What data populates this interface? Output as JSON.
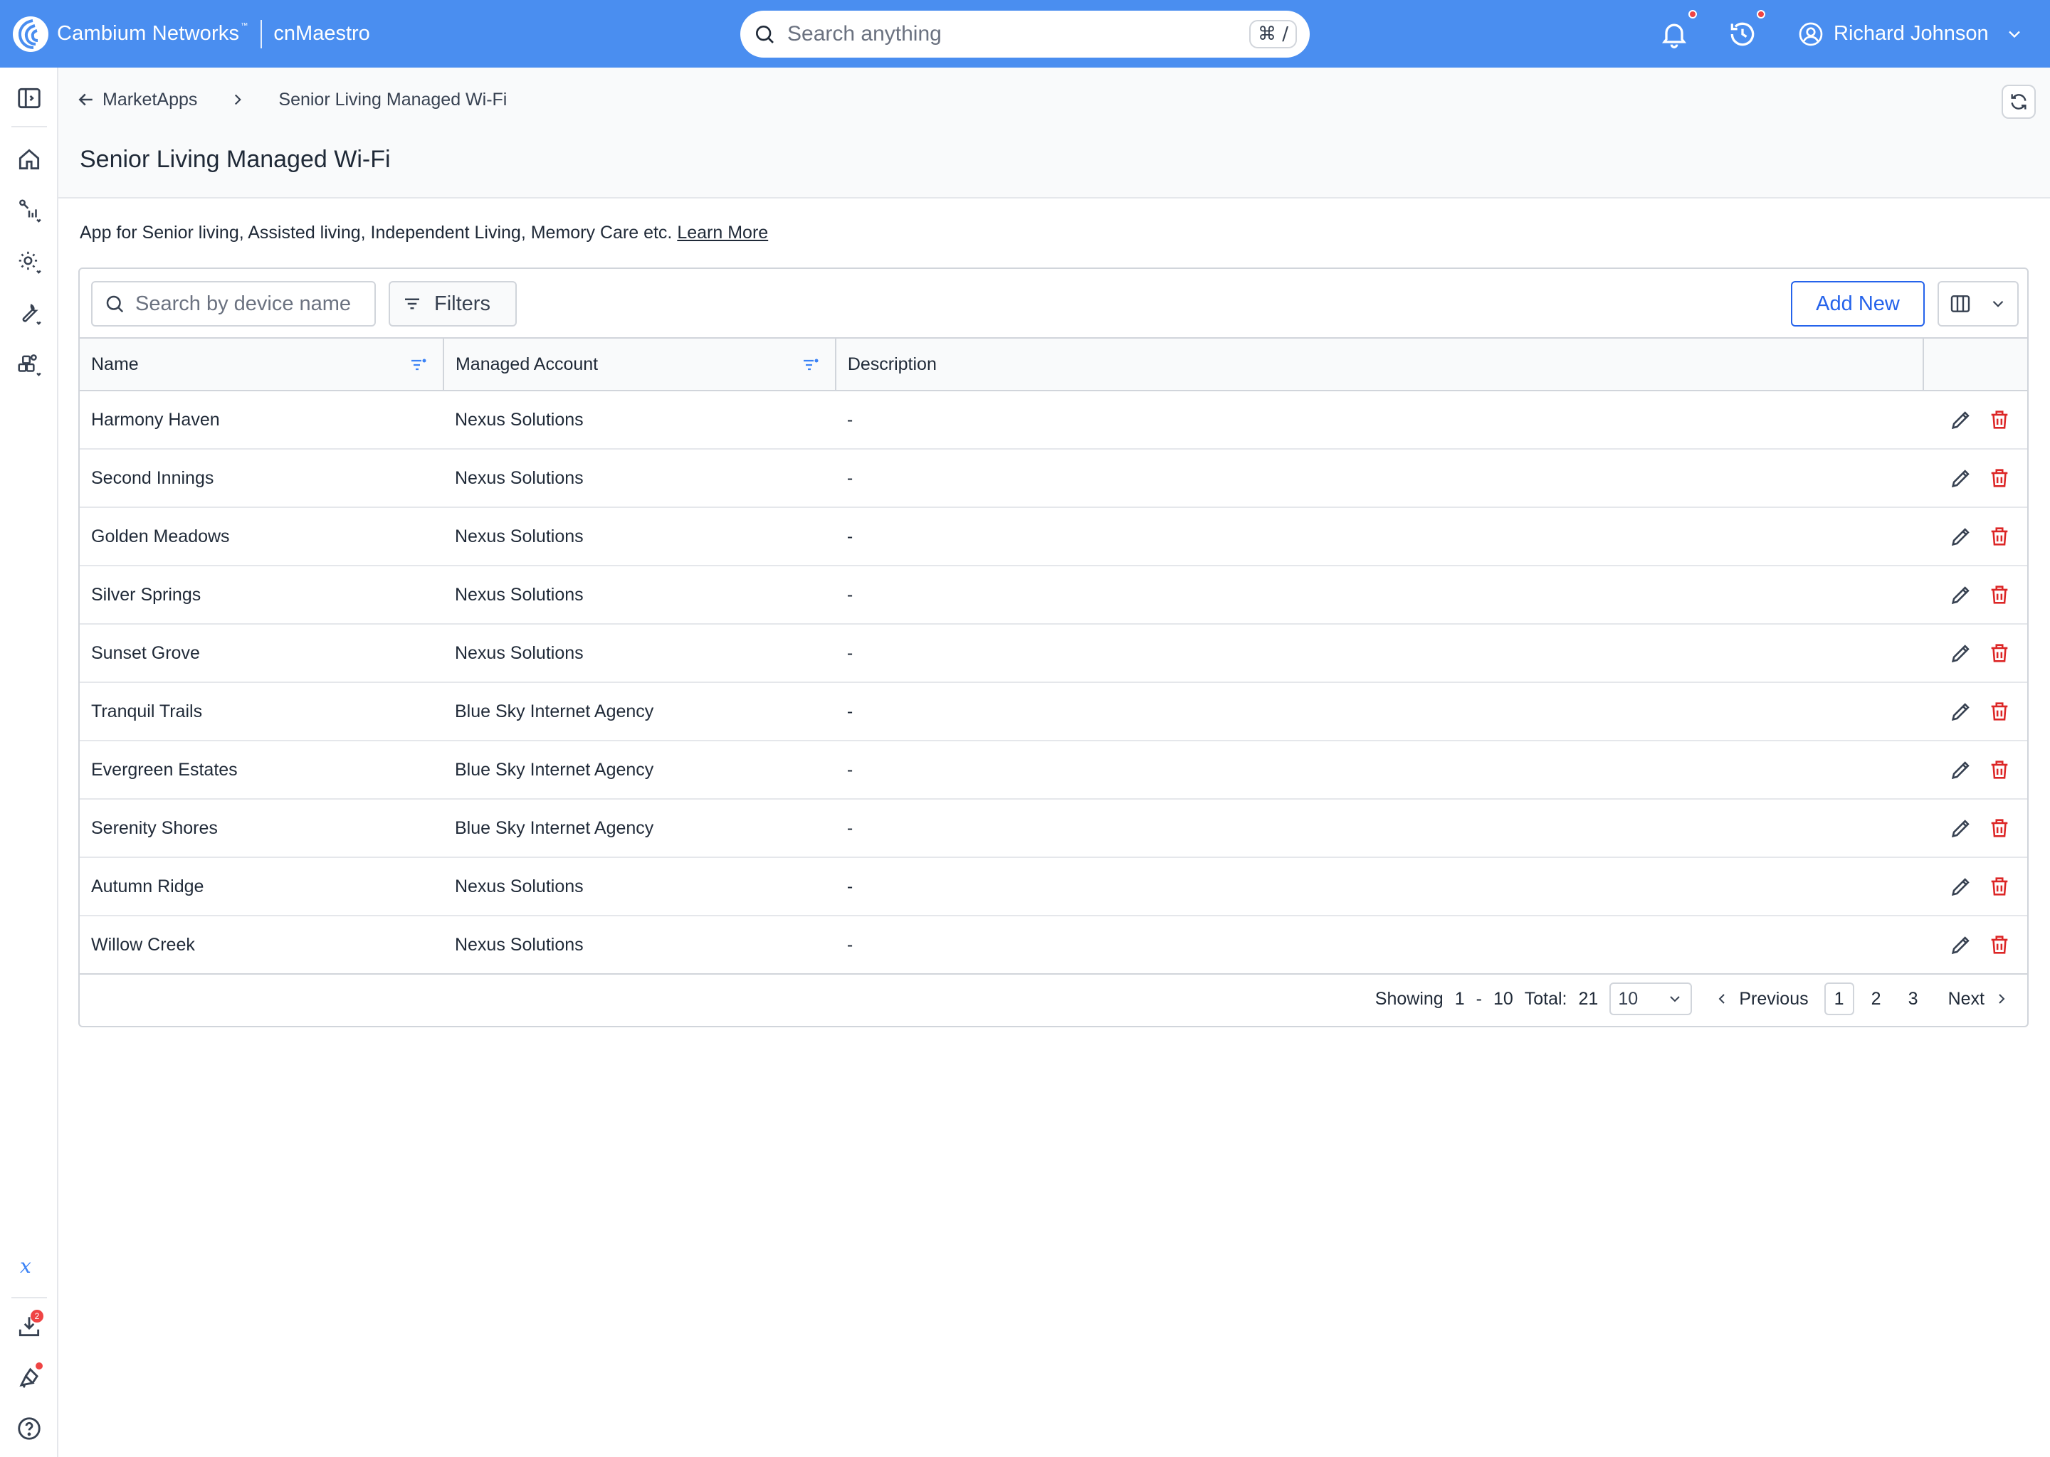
{
  "topbar": {
    "company": "Cambium Networks",
    "trademark": "™",
    "product": "cnMaestro",
    "search_placeholder": "Search anything",
    "search_shortcut": "⌘ /",
    "user_name": "Richard Johnson",
    "icons": [
      "cambium-logo-icon",
      "bell-icon",
      "activity-history-icon",
      "user-circle-icon",
      "chevron-down-icon"
    ]
  },
  "rail": {
    "icons": [
      "sidebar-toggle-icon",
      "home-icon",
      "monitor-icon",
      "configure-icon",
      "tools-icon",
      "apps-icon",
      "x-logo-icon",
      "download-icon",
      "announcement-icon",
      "help-icon"
    ],
    "download_badge": "2"
  },
  "breadcrumb": {
    "parent": "MarketApps",
    "current": "Senior Living Managed Wi-Fi"
  },
  "page": {
    "title": "Senior Living Managed Wi-Fi",
    "description": "App for Senior living, Assisted living, Independent Living, Memory Care etc.",
    "learn_more": "Learn More"
  },
  "toolbar": {
    "search_placeholder": "Search by device name",
    "filters_label": "Filters",
    "add_label": "Add New"
  },
  "table": {
    "columns": [
      "Name",
      "Managed Account",
      "Description"
    ],
    "rows": [
      {
        "name": "Harmony Haven",
        "account": "Nexus Solutions",
        "description": "-"
      },
      {
        "name": "Second Innings",
        "account": "Nexus Solutions",
        "description": "-"
      },
      {
        "name": "Golden Meadows",
        "account": "Nexus Solutions",
        "description": "-"
      },
      {
        "name": "Silver Springs",
        "account": "Nexus Solutions",
        "description": "-"
      },
      {
        "name": "Sunset Grove",
        "account": "Nexus Solutions",
        "description": "-"
      },
      {
        "name": "Tranquil Trails",
        "account": "Blue Sky Internet Agency",
        "description": "-"
      },
      {
        "name": "Evergreen Estates",
        "account": "Blue Sky Internet Agency",
        "description": "-"
      },
      {
        "name": "Serenity Shores",
        "account": "Blue Sky Internet Agency",
        "description": "-"
      },
      {
        "name": "Autumn Ridge",
        "account": "Nexus Solutions",
        "description": "-"
      },
      {
        "name": "Willow Creek",
        "account": "Nexus Solutions",
        "description": "-"
      }
    ]
  },
  "pagination": {
    "showing_label": "Showing",
    "range_start": "1",
    "range_dash": "-",
    "range_end": "10",
    "total_label": "Total:",
    "total": "21",
    "page_size": "10",
    "prev_label": "Previous",
    "next_label": "Next",
    "pages": [
      "1",
      "2",
      "3"
    ]
  },
  "colors": {
    "brand_blue": "#4a8ef0",
    "accent": "#2563eb",
    "danger": "#dc2626",
    "notification_dot": "#ef4444"
  }
}
